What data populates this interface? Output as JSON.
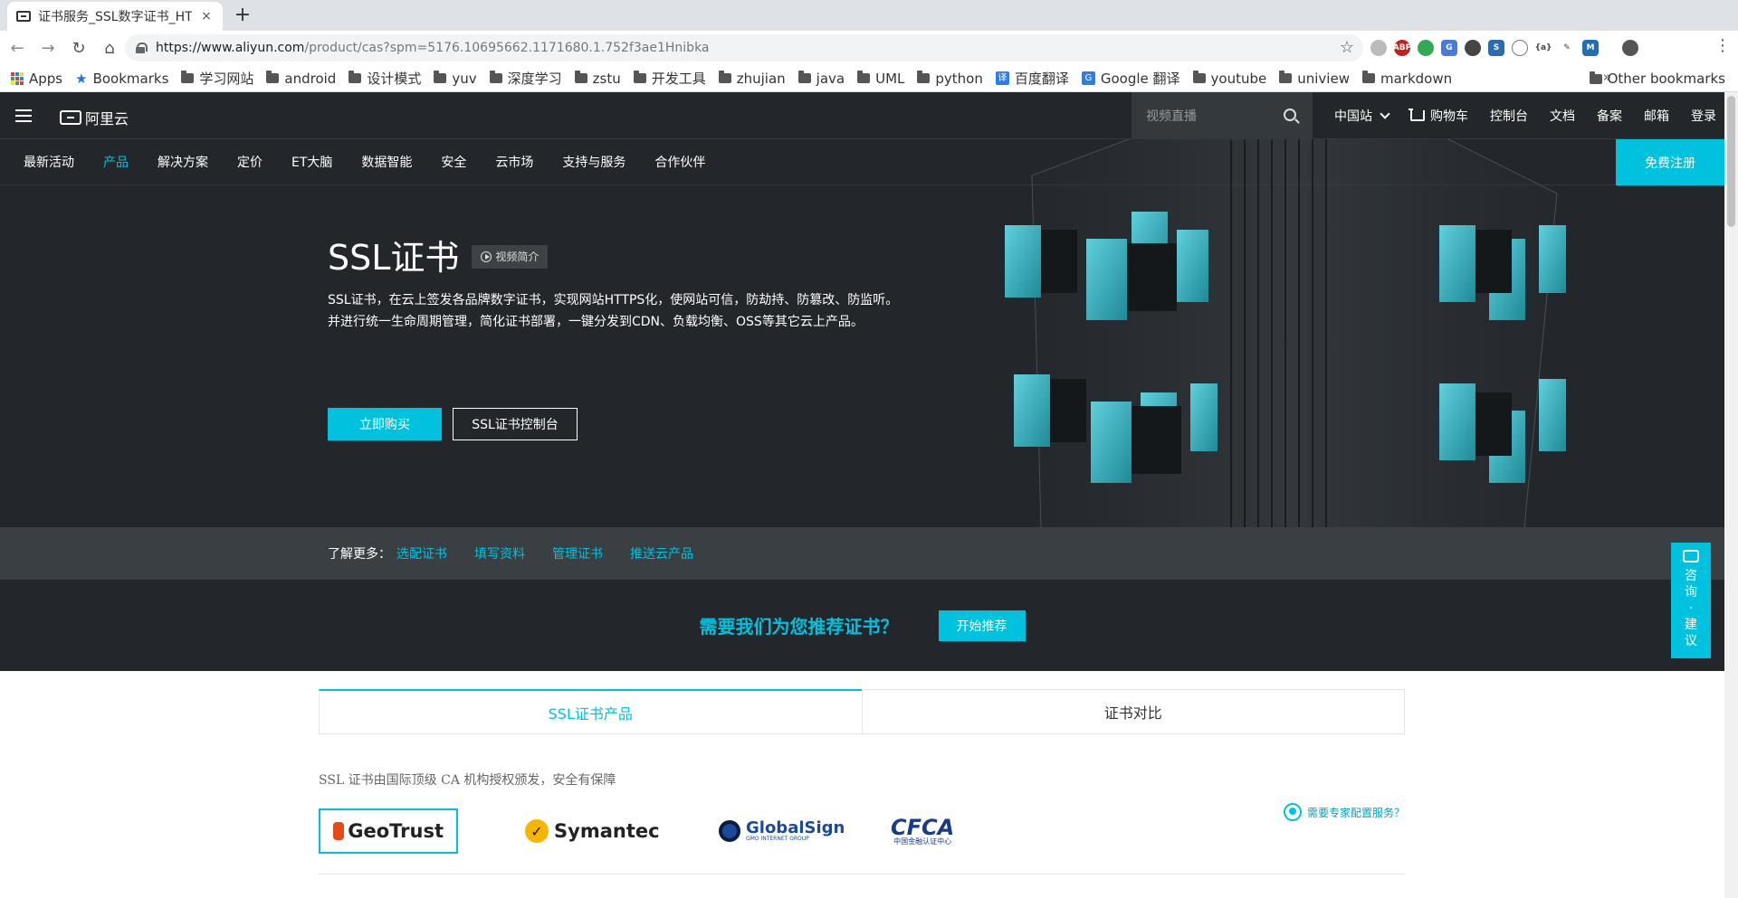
{
  "browser": {
    "tab_title": "证书服务_SSL数字证书_HT",
    "tab_close": "×",
    "new_tab": "+",
    "url_host": "https://www.aliyun.com",
    "url_rest": "/product/cas?spm=5176.10695662.1171680.1.752f3ae1Hnibka",
    "bookmarks": [
      "Apps",
      "Bookmarks",
      "学习网站",
      "android",
      "设计模式",
      "yuv",
      "深度学习",
      "zstu",
      "开发工具",
      "zhujian",
      "java",
      "UML",
      "python",
      "百度翻译",
      "Google 翻译",
      "youtube",
      "uniview",
      "markdown"
    ],
    "more": "»",
    "other_bookmarks": "Other bookmarks"
  },
  "site": {
    "logo": "阿里云",
    "search_placeholder": "视频直播",
    "top_links": [
      "中国站",
      "购物车",
      "控制台",
      "文档",
      "备案",
      "邮箱",
      "登录"
    ],
    "nav": [
      "最新活动",
      "产品",
      "解决方案",
      "定价",
      "ET大脑",
      "数据智能",
      "安全",
      "云市场",
      "支持与服务",
      "合作伙伴"
    ],
    "active_nav": "产品",
    "register": "免费注册"
  },
  "hero": {
    "title": "SSL证书",
    "video_label": "视频简介",
    "desc_line1": "SSL证书，在云上签发各品牌数字证书，实现网站HTTPS化，使网站可信，防劫持、防篡改、防监听。",
    "desc_line2": "并进行统一生命周期管理，简化证书部署，一键分发到CDN、负载均衡、OSS等其它云上产品。",
    "buy": "立即购买",
    "console": "SSL证书控制台"
  },
  "learn_more": {
    "label": "了解更多：",
    "links": [
      "选配证书",
      "填写资料",
      "管理证书",
      "推送云产品"
    ]
  },
  "recommend": {
    "text": "需要我们为您推荐证书？",
    "button": "开始推荐"
  },
  "products": {
    "tabs": [
      "SSL证书产品",
      "证书对比"
    ],
    "intro": "SSL 证书由国际顶级 CA 机构授权颁发，安全有保障",
    "brands": [
      "GeoTrust",
      "Symantec",
      "GlobalSign",
      "CFCA"
    ],
    "brand_sub": {
      "globalsign": "GMO INTERNET GROUP",
      "cfca": "中国金融认证中心"
    },
    "expert": "需要专家配置服务？"
  },
  "consult": {
    "label_chars": [
      "咨",
      "询",
      "·",
      "建",
      "议"
    ]
  },
  "colors": {
    "accent": "#00c1de",
    "hero_bg": "#23272b"
  }
}
